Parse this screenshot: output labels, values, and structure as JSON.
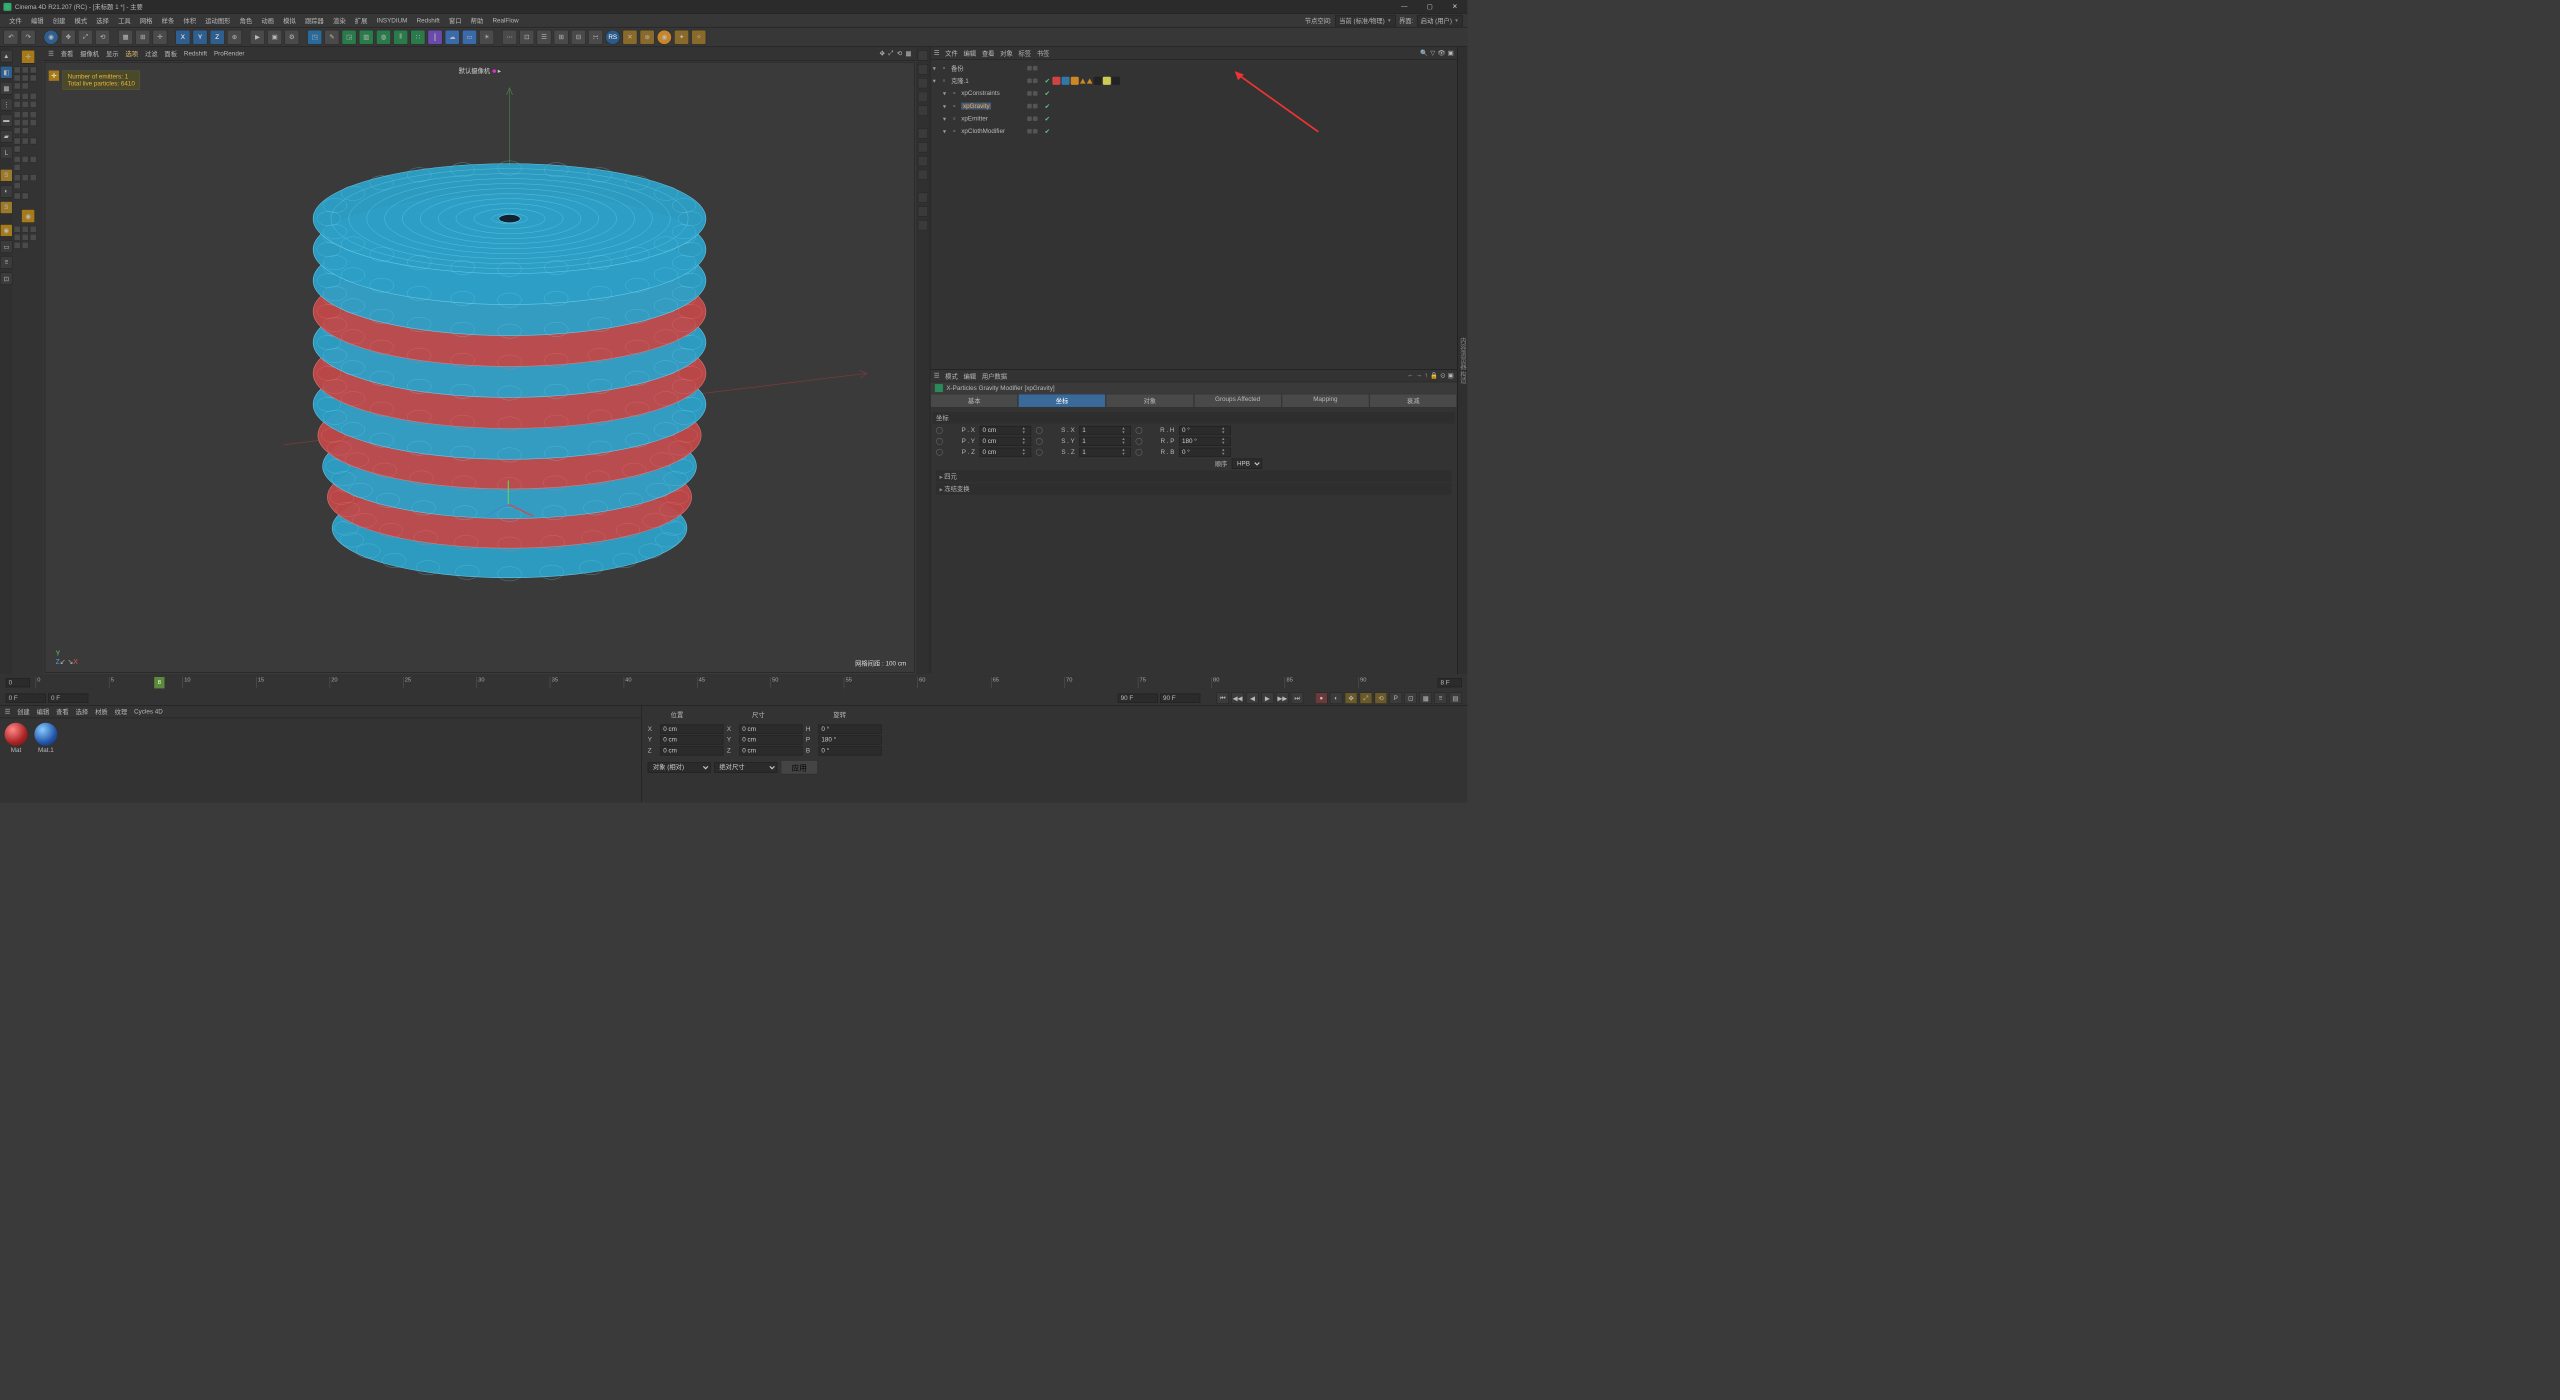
{
  "title": "Cinema 4D R21.207 (RC) - [未标题 1 *] - 主要",
  "menus": [
    "文件",
    "编辑",
    "创建",
    "模式",
    "选择",
    "工具",
    "网格",
    "样条",
    "体积",
    "运动图形",
    "角色",
    "动画",
    "模拟",
    "跟踪器",
    "渲染",
    "扩展",
    "INSYDIUM",
    "Redshift",
    "窗口",
    "帮助",
    "RealFlow"
  ],
  "layout_right": {
    "nodespace_label": "节点空间:",
    "nodespace_value": "当前 (标准/物理)",
    "layout_label": "界面:",
    "layout_value": "启动 (用户)"
  },
  "viewtabs": [
    "查看",
    "摄像机",
    "显示",
    "选项",
    "过滤",
    "面板",
    "Redshift",
    "ProRender"
  ],
  "viewtabs_sel": 3,
  "camera_label": "默认摄像机",
  "hud": {
    "l1": "Number of emitters: 1",
    "l2": "Total live particles: 6410"
  },
  "gridinfo": "网格间距 : 100 cm",
  "objmenu": [
    "文件",
    "编辑",
    "查看",
    "对象",
    "标签",
    "书签"
  ],
  "objects": [
    {
      "name": "备份",
      "icon": "folder",
      "vis": true,
      "tags": []
    },
    {
      "name": "克隆.1",
      "icon": "cloner",
      "vis": true,
      "chk": true,
      "tags": [
        "r",
        "b",
        "o",
        "tri",
        "tri",
        "k",
        "y",
        "k"
      ]
    },
    {
      "name": "xpConstraints",
      "icon": "xp",
      "indent": 1,
      "vis": true,
      "chk": true
    },
    {
      "name": "xpGravity",
      "icon": "xp",
      "indent": 1,
      "vis": true,
      "chk": true,
      "sel": true
    },
    {
      "name": "xpEmitter",
      "icon": "xp",
      "indent": 1,
      "vis": true,
      "chk": true
    },
    {
      "name": "xpClothModifier",
      "icon": "xp",
      "indent": 1,
      "vis": true,
      "chk": true
    }
  ],
  "attrmenu": [
    "模式",
    "编辑",
    "用户数据"
  ],
  "attr_title": "X-Particles Gravity Modifier [xpGravity]",
  "attr_tabs": [
    "基本",
    "坐标",
    "对象",
    "Groups Affected",
    "Mapping",
    "衰减"
  ],
  "attr_tab_sel": 1,
  "coord_section": "坐标",
  "coords": {
    "P.X": "0 cm",
    "P.Y": "0 cm",
    "P.Z": "0 cm",
    "S.X": "1",
    "S.Y": "1",
    "S.Z": "1",
    "R.H": "0 °",
    "R.P": "180 °",
    "R.B": "0 °",
    "order_label": "顺序",
    "order_value": "HPB"
  },
  "attr_collapse": [
    "四元",
    "冻结变换"
  ],
  "timeline": {
    "start": "0",
    "end": "90",
    "cur": "8",
    "min": "0 F",
    "max": "90 F",
    "maxR": "90 F",
    "curField": "8 F",
    "ticks": [
      0,
      5,
      10,
      15,
      20,
      25,
      30,
      35,
      40,
      45,
      50,
      55,
      60,
      65,
      70,
      75,
      80,
      85,
      90
    ]
  },
  "matmenu": [
    "创建",
    "编辑",
    "查看",
    "选择",
    "材质",
    "纹理",
    "Cycles 4D"
  ],
  "materials": [
    {
      "name": "Mat",
      "color": "r"
    },
    {
      "name": "Mat.1",
      "color": "b"
    }
  ],
  "coordpanel": {
    "hdrs": [
      "位置",
      "尺寸",
      "旋转"
    ],
    "rows": [
      {
        "a": "X",
        "p": "0 cm",
        "s": "0 cm",
        "rl": "H",
        "r": "0 °"
      },
      {
        "a": "Y",
        "p": "0 cm",
        "s": "0 cm",
        "rl": "P",
        "r": "180 °"
      },
      {
        "a": "Z",
        "p": "0 cm",
        "s": "0 cm",
        "rl": "B",
        "r": "0 °"
      }
    ],
    "mode1": "对象 (相对)",
    "mode2": "绝对尺寸",
    "apply": "应用"
  },
  "side_label": "内容浏览器 构造"
}
